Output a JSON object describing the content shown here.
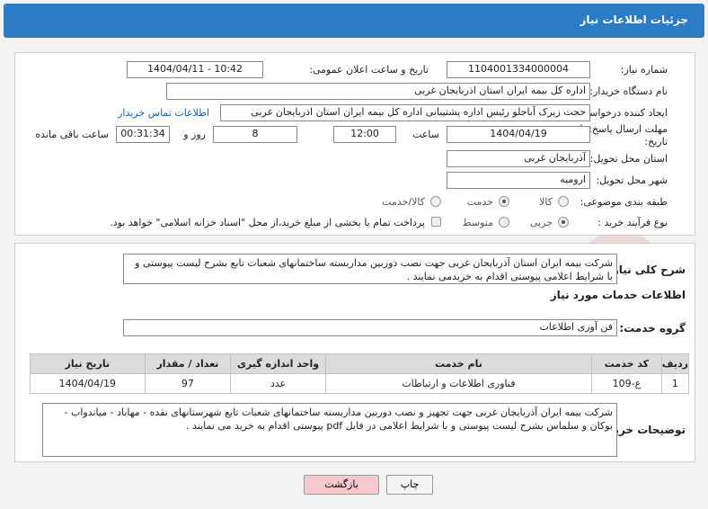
{
  "header": {
    "title": "جزئیات اطلاعات نیاز"
  },
  "form": {
    "need_number_label": "شماره نیاز:",
    "need_number": "1104001334000004",
    "announce_label": "تاریخ و ساعت اعلان عمومی:",
    "announce_value": "1404/04/11 - 10:42",
    "buyer_label": "نام دستگاه خریدار:",
    "buyer_value": "اداره کل بیمه ایران استان اذربایجان غربی",
    "creator_label": "ایجاد کننده درخواست:",
    "creator_value": "حجت زیرک آباجلو رئیس اداره پشتیبانی اداره کل بیمه ایران استان اذربایجان غربی",
    "contact_link": "اطلاعات تماس خریدار",
    "deadline_label_1": "مهلت ارسال پاسخ: تا",
    "deadline_label_2": "تاریخ:",
    "deadline_date": "1404/04/19",
    "time_label": "ساعت",
    "deadline_time": "12:00",
    "days_value": "8",
    "days_label": "روز و",
    "remain_time": "00:31:34",
    "remain_label": "ساعت باقی مانده",
    "province_label": "استان محل تحویل:",
    "province_value": "آذربایجان غربی",
    "city_label": "شهر محل تحویل:",
    "city_value": "ارومیه",
    "category_label": "طبقه بندی موضوعی:",
    "category_options": [
      "کالا",
      "خدمت",
      "کالا/خدمت"
    ],
    "category_selected": "خدمت",
    "process_label": "نوع فرآیند خرید :",
    "process_options": [
      "جزیی",
      "متوسط"
    ],
    "process_selected": "جزیی",
    "payment_note": "پرداخت تمام یا بخشی از مبلغ خرید،از محل \"اسناد خزانه اسلامی\" خواهد بود."
  },
  "details": {
    "summary_label": "شرح کلی نیاز:",
    "summary_value": "شرکت بیمه ایران استان آذربایجان غربی جهت نصب دوربین مداربسته ساختمانهای شعبات تابع بشرح لیست پیوستی و با شرایط اعلامی پیوستی اقدام به خریدمی نمایند .",
    "services_title": "اطلاعات خدمات مورد نیاز",
    "service_group_label": "گروه خدمت:",
    "service_group_value": "فن آوری اطلاعات",
    "table": {
      "headers": [
        "ردیف",
        "کد خدمت",
        "نام خدمت",
        "واحد اندازه گیری",
        "تعداد / مقدار",
        "تاریخ نیاز"
      ],
      "rows": [
        [
          "1",
          "ع-109",
          "فناوری اطلاعات و ارتباطات",
          "عدد",
          "97",
          "1404/04/19"
        ]
      ]
    },
    "buyer_notes_label": "توضیحات خریدار:",
    "buyer_notes_value": "شرکت بیمه ایران آذربایجان غربی جهت تجهیز و نصب دوربین مداربسته ساختمانهای شعبات تابع شهرستانهای نقده - مهاباد - میاندواب - بوکان و سلماس بشرح لیست پیوستی و با شرایط اعلامی در فایل pdf پیوستی اقدام  به خرید می نمایند ."
  },
  "buttons": {
    "print": "چاپ",
    "back": "بازگشت"
  },
  "colors": {
    "header_bg": "#2b7cc4",
    "link": "#1a5fb4",
    "back_btn_bg": "#f7c9cf"
  }
}
